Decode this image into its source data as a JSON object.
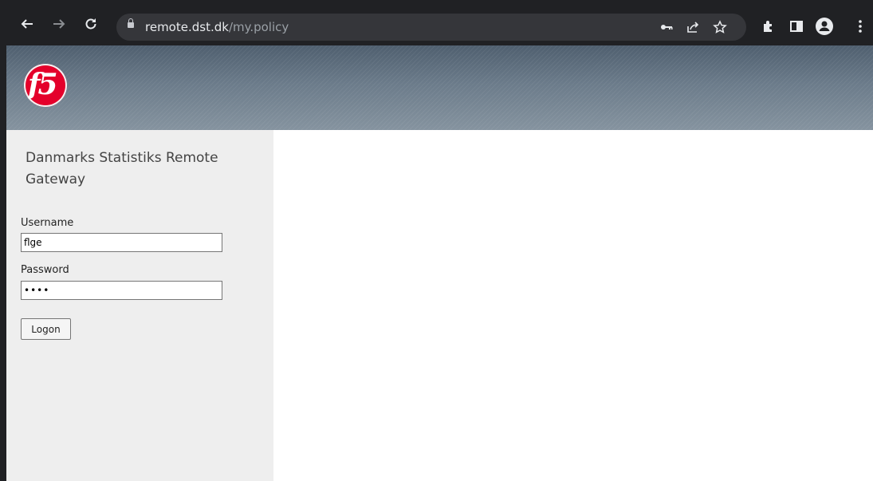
{
  "browser": {
    "url_host": "remote.dst.dk",
    "url_path": "/my.policy",
    "icons": [
      "back-arrow-icon",
      "forward-arrow-icon",
      "reload-icon",
      "lock-icon",
      "key-icon",
      "share-icon",
      "star-icon",
      "extensions-icon",
      "side-panel-icon",
      "profile-icon",
      "menu-icon"
    ]
  },
  "banner": {
    "logo_text": "f5"
  },
  "login": {
    "title": "Danmarks Statistiks Remote Gateway",
    "username_label": "Username",
    "username_value": "flge",
    "password_label": "Password",
    "password_value": "••••",
    "logon_label": "Logon"
  },
  "colors": {
    "chrome": "#202124",
    "omnibox": "#35363a",
    "sidebar": "#eeeeee",
    "f5_red": "#e4002b"
  }
}
